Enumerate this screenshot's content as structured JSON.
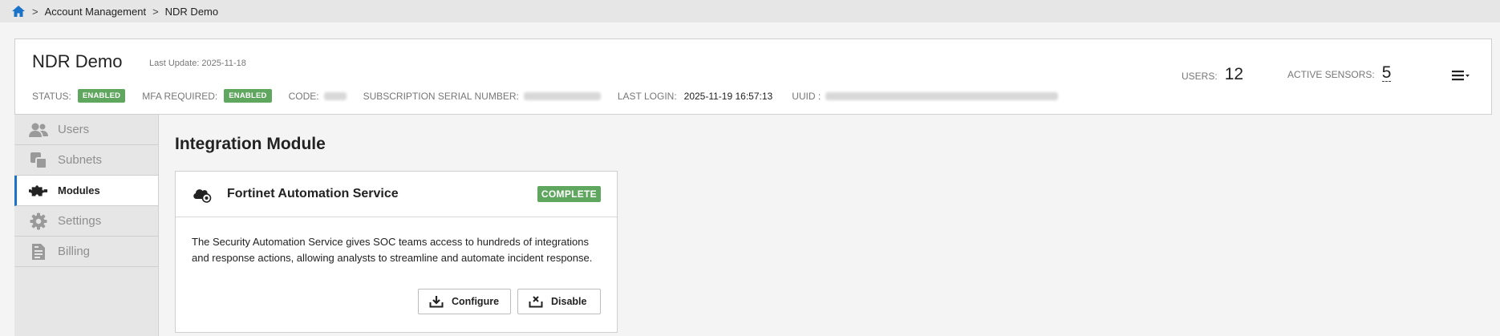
{
  "breadcrumb": {
    "separator": ">",
    "items": [
      "Account Management",
      "NDR Demo"
    ]
  },
  "header": {
    "title": "NDR Demo",
    "last_update": "Last Update: 2025-11-18",
    "status_label": "STATUS:",
    "status_value": "ENABLED",
    "mfa_label": "MFA REQUIRED:",
    "mfa_value": "ENABLED",
    "code_label": "CODE:",
    "serial_label": "SUBSCRIPTION SERIAL NUMBER:",
    "last_login_label": "LAST LOGIN:",
    "last_login_value": "2025-11-19 16:57:13",
    "uuid_label": "UUID :",
    "users_label": "USERS:",
    "users_value": "12",
    "sensors_label": "ACTIVE SENSORS:",
    "sensors_value": "5",
    "menu_icon": "hamburger-dropdown-icon"
  },
  "sidebar": {
    "items": [
      {
        "label": "Users",
        "icon": "users-icon",
        "active": false
      },
      {
        "label": "Subnets",
        "icon": "subnets-icon",
        "active": false
      },
      {
        "label": "Modules",
        "icon": "puzzle-icon",
        "active": true
      },
      {
        "label": "Settings",
        "icon": "gear-icon",
        "active": false
      },
      {
        "label": "Billing",
        "icon": "billing-icon",
        "active": false
      }
    ]
  },
  "main": {
    "heading": "Integration Module",
    "card": {
      "title": "Fortinet Automation Service",
      "status": "COMPLETE",
      "description": "The Security Automation Service gives SOC teams access to hundreds of integrations and response actions, allowing analysts to streamline and automate incident response.",
      "configure_label": "Configure",
      "disable_label": "Disable"
    }
  },
  "colors": {
    "badge_green": "#5fa65f",
    "active_accent": "#1a73c9",
    "home_icon": "#1a73c9"
  }
}
